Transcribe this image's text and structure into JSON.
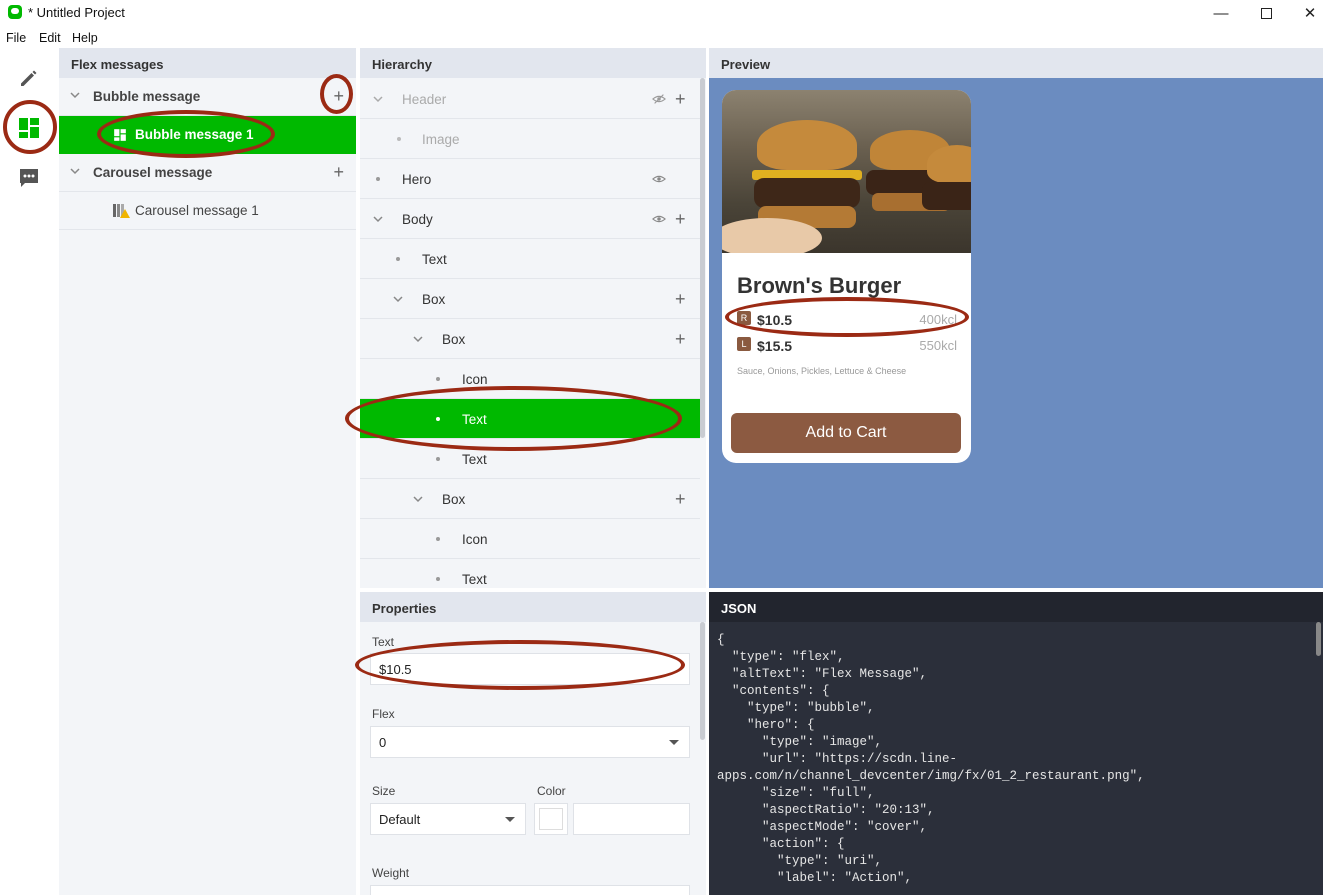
{
  "window": {
    "title": "* Untitled Project",
    "min": "—",
    "close": "✕"
  },
  "menu": [
    "File",
    "Edit",
    "Help"
  ],
  "rail": {
    "icons": [
      "pencil-icon",
      "layout-icon",
      "chat-icon"
    ],
    "active_color": "#00b900"
  },
  "flex_panel": {
    "title": "Flex messages",
    "groups": [
      {
        "label": "Bubble message",
        "items": [
          "Bubble message 1"
        ]
      },
      {
        "label": "Carousel message",
        "items": [
          "Carousel message 1"
        ]
      }
    ],
    "add": "+"
  },
  "hierarchy": {
    "title": "Hierarchy",
    "rows": [
      {
        "label": "Header"
      },
      {
        "label": "Image"
      },
      {
        "label": "Hero"
      },
      {
        "label": "Body"
      },
      {
        "label": "Text"
      },
      {
        "label": "Box"
      },
      {
        "label": "Box"
      },
      {
        "label": "Icon"
      },
      {
        "label": "Text"
      },
      {
        "label": "Text"
      },
      {
        "label": "Box"
      },
      {
        "label": "Icon"
      },
      {
        "label": "Text"
      }
    ],
    "add": "+"
  },
  "preview": {
    "title": "Preview",
    "bg_color": "#6b8cc0",
    "card": {
      "title": "Brown's Burger",
      "prices": [
        {
          "badge": "R",
          "price": "$10.5",
          "kcal": "400kcl"
        },
        {
          "badge": "L",
          "price": "$15.5",
          "kcal": "550kcl"
        }
      ],
      "description": "Sauce, Onions, Pickles, Lettuce & Cheese",
      "button": "Add to Cart",
      "button_color": "#8c5a41"
    }
  },
  "properties": {
    "title": "Properties",
    "text_label": "Text",
    "text_value": "$10.5",
    "flex_label": "Flex",
    "flex_value": "0",
    "size_label": "Size",
    "size_value": "Default",
    "color_label": "Color",
    "color_value": "",
    "weight_label": "Weight"
  },
  "json": {
    "title": "JSON",
    "code": "{\n  \"type\": \"flex\",\n  \"altText\": \"Flex Message\",\n  \"contents\": {\n    \"type\": \"bubble\",\n    \"hero\": {\n      \"type\": \"image\",\n      \"url\": \"https://scdn.line-\napps.com/n/channel_devcenter/img/fx/01_2_restaurant.png\",\n      \"size\": \"full\",\n      \"aspectRatio\": \"20:13\",\n      \"aspectMode\": \"cover\",\n      \"action\": {\n        \"type\": \"uri\",\n        \"label\": \"Action\","
  },
  "colors": {
    "selected": "#00b900",
    "annotation": "#9b2a14"
  }
}
